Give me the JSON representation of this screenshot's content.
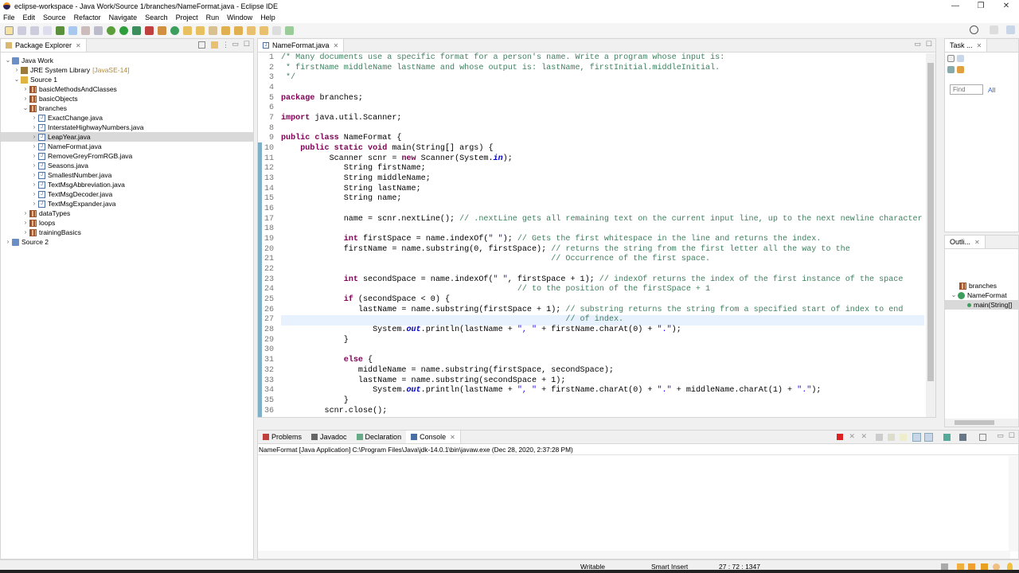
{
  "window": {
    "title": "eclipse-workspace - Java Work/Source 1/branches/NameFormat.java - Eclipse IDE",
    "minimize": "—",
    "maximize": "❐",
    "close": "✕"
  },
  "menu": [
    "File",
    "Edit",
    "Source",
    "Refactor",
    "Navigate",
    "Search",
    "Project",
    "Run",
    "Window",
    "Help"
  ],
  "package_explorer": {
    "title": "Package Explorer",
    "tree": [
      {
        "label": "Java Work",
        "depth": 0,
        "icon": "project-icon",
        "expanded": true
      },
      {
        "label": "JRE System Library",
        "suffix": "[JavaSE-14]",
        "depth": 1,
        "icon": "library-icon",
        "expanded": false
      },
      {
        "label": "Source 1",
        "depth": 1,
        "icon": "source-folder-icon",
        "expanded": true
      },
      {
        "label": "basicMethodsAndClasses",
        "depth": 2,
        "icon": "package-icon",
        "expanded": false
      },
      {
        "label": "basicObjects",
        "depth": 2,
        "icon": "package-icon",
        "expanded": false
      },
      {
        "label": "branches",
        "depth": 2,
        "icon": "package-icon",
        "expanded": true
      },
      {
        "label": "ExactChange.java",
        "depth": 3,
        "icon": "java-file-icon",
        "expanded": false
      },
      {
        "label": "InterstateHighwayNumbers.java",
        "depth": 3,
        "icon": "java-file-icon",
        "expanded": false
      },
      {
        "label": "LeapYear.java",
        "depth": 3,
        "icon": "java-file-icon",
        "expanded": false,
        "selected": true
      },
      {
        "label": "NameFormat.java",
        "depth": 3,
        "icon": "java-file-icon",
        "expanded": false
      },
      {
        "label": "RemoveGreyFromRGB.java",
        "depth": 3,
        "icon": "java-file-icon",
        "expanded": false
      },
      {
        "label": "Seasons.java",
        "depth": 3,
        "icon": "java-file-icon",
        "expanded": false
      },
      {
        "label": "SmallestNumber.java",
        "depth": 3,
        "icon": "java-file-icon",
        "expanded": false
      },
      {
        "label": "TextMsgAbbreviation.java",
        "depth": 3,
        "icon": "java-file-icon",
        "expanded": false
      },
      {
        "label": "TextMsgDecoder.java",
        "depth": 3,
        "icon": "java-file-icon",
        "expanded": false
      },
      {
        "label": "TextMsgExpander.java",
        "depth": 3,
        "icon": "java-file-icon",
        "expanded": false
      },
      {
        "label": "dataTypes",
        "depth": 2,
        "icon": "package-icon",
        "expanded": false
      },
      {
        "label": "loops",
        "depth": 2,
        "icon": "package-icon",
        "expanded": false
      },
      {
        "label": "trainingBasics",
        "depth": 2,
        "icon": "package-icon",
        "expanded": false
      },
      {
        "label": "Source 2",
        "depth": 0,
        "icon": "project-icon",
        "expanded": false
      }
    ]
  },
  "editor": {
    "tab": "NameFormat.java",
    "current_line": 27,
    "lines": [
      [
        [
          "c",
          "/* Many documents use a specific format for a person's name. Write a program whose input is:"
        ]
      ],
      [
        [
          "c",
          " * firstName middleName lastName and whose output is: lastName, firstInitial.middleInitial."
        ]
      ],
      [
        [
          "c",
          " */"
        ]
      ],
      [],
      [
        [
          "k",
          "package"
        ],
        [
          "p",
          " branches;"
        ]
      ],
      [],
      [
        [
          "k",
          "import"
        ],
        [
          "p",
          " java.util.Scanner;"
        ]
      ],
      [],
      [
        [
          "k",
          "public"
        ],
        [
          "p",
          " "
        ],
        [
          "k",
          "class"
        ],
        [
          "p",
          " NameFormat {"
        ]
      ],
      [
        [
          "p",
          "    "
        ],
        [
          "k",
          "public"
        ],
        [
          "p",
          " "
        ],
        [
          "k",
          "static"
        ],
        [
          "p",
          " "
        ],
        [
          "k",
          "void"
        ],
        [
          "p",
          " main(String[] args) {"
        ]
      ],
      [
        [
          "p",
          "          Scanner scnr = "
        ],
        [
          "k",
          "new"
        ],
        [
          "p",
          " Scanner(System."
        ],
        [
          "f",
          "in"
        ],
        [
          "p",
          ");"
        ]
      ],
      [
        [
          "p",
          "             String firstName;"
        ]
      ],
      [
        [
          "p",
          "             String middleName;"
        ]
      ],
      [
        [
          "p",
          "             String lastName;"
        ]
      ],
      [
        [
          "p",
          "             String name;"
        ]
      ],
      [],
      [
        [
          "p",
          "             name = scnr.nextLine(); "
        ],
        [
          "c",
          "// .nextLine gets all remaining text on the current input line, up to the next newline character"
        ]
      ],
      [],
      [
        [
          "p",
          "             "
        ],
        [
          "k",
          "int"
        ],
        [
          "p",
          " firstSpace = name.indexOf("
        ],
        [
          "s",
          "\" \""
        ],
        [
          "p",
          "); "
        ],
        [
          "c",
          "// Gets the first whitespace in the line and returns the index."
        ]
      ],
      [
        [
          "p",
          "             firstName = name.substring(0, firstSpace); "
        ],
        [
          "c",
          "// returns the string from the first letter all the way to the"
        ]
      ],
      [
        [
          "p",
          "                                                        "
        ],
        [
          "c",
          "// Occurrence of the first space."
        ]
      ],
      [],
      [
        [
          "p",
          "             "
        ],
        [
          "k",
          "int"
        ],
        [
          "p",
          " secondSpace = name.indexOf("
        ],
        [
          "s",
          "\" \""
        ],
        [
          "p",
          ", firstSpace + 1); "
        ],
        [
          "c",
          "// indexOf returns the index of the first instance of the space"
        ]
      ],
      [
        [
          "p",
          "                                                 "
        ],
        [
          "c",
          "// to the position of the firstSpace + 1"
        ]
      ],
      [
        [
          "p",
          "             "
        ],
        [
          "k",
          "if"
        ],
        [
          "p",
          " (secondSpace < 0) {"
        ]
      ],
      [
        [
          "p",
          "                lastName = name.substring(firstSpace + 1); "
        ],
        [
          "c",
          "// substring returns the string from a specified start of index to end"
        ]
      ],
      [
        [
          "p",
          "                                                           "
        ],
        [
          "c",
          "// of index."
        ]
      ],
      [
        [
          "p",
          "                   System."
        ],
        [
          "f",
          "out"
        ],
        [
          "p",
          ".println(lastName + "
        ],
        [
          "s",
          "\", \""
        ],
        [
          "p",
          " + firstName.charAt(0) + "
        ],
        [
          "s",
          "\".\""
        ],
        [
          "p",
          ");"
        ]
      ],
      [
        [
          "p",
          "             }"
        ]
      ],
      [],
      [
        [
          "p",
          "             "
        ],
        [
          "k",
          "else"
        ],
        [
          "p",
          " {"
        ]
      ],
      [
        [
          "p",
          "                middleName = name.substring(firstSpace, secondSpace);"
        ]
      ],
      [
        [
          "p",
          "                lastName = name.substring(secondSpace + 1);"
        ]
      ],
      [
        [
          "p",
          "                   System."
        ],
        [
          "f",
          "out"
        ],
        [
          "p",
          ".println(lastName + "
        ],
        [
          "s",
          "\", \""
        ],
        [
          "p",
          " + firstName.charAt(0) + "
        ],
        [
          "s",
          "\".\""
        ],
        [
          "p",
          " + middleName.charAt(1) + "
        ],
        [
          "s",
          "\".\""
        ],
        [
          "p",
          ");"
        ]
      ],
      [
        [
          "p",
          "             }"
        ]
      ],
      [
        [
          "p",
          "         scnr.close();"
        ]
      ]
    ]
  },
  "task_list": {
    "title": "Task ...",
    "find_placeholder": "Find",
    "all_label": "All"
  },
  "outline": {
    "title": "Outli...",
    "items": [
      "branches",
      "NameFormat",
      "main(String[]"
    ]
  },
  "console": {
    "tabs": [
      "Problems",
      "Javadoc",
      "Declaration",
      "Console"
    ],
    "active_tab": "Console",
    "header": "NameFormat [Java Application] C:\\Program Files\\Java\\jdk-14.0.1\\bin\\javaw.exe  (Dec 28, 2020, 2:37:28 PM)"
  },
  "status": {
    "mode": "Writable",
    "insert": "Smart Insert",
    "position": "27 : 72 : 1347"
  }
}
